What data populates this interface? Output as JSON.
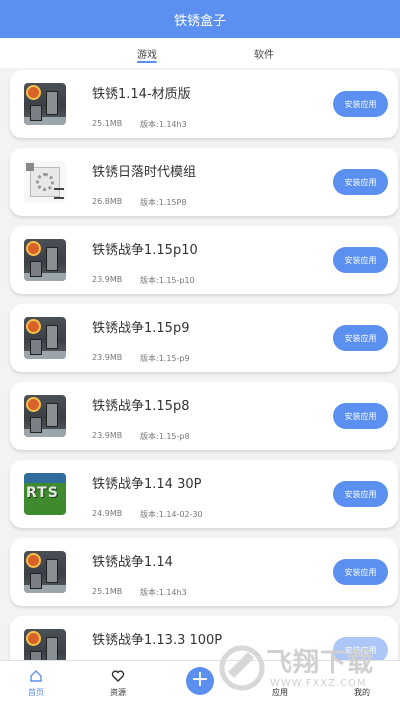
{
  "header": {
    "title": "铁锈盒子"
  },
  "tabs": [
    {
      "label": "游戏",
      "active": true
    },
    {
      "label": "软件",
      "active": false
    }
  ],
  "colors": {
    "accent": "#5b8ff0",
    "background": "#f2f3f5"
  },
  "apps": [
    {
      "name": "铁锈1.14-材质版",
      "size": "25.1MB",
      "version": "版本:1.14h3",
      "icon": "rust-war-icon",
      "button": "安装应用"
    },
    {
      "name": "铁锈日落时代模组",
      "size": "26.8MB",
      "version": "版本:1.15P8",
      "icon": "mod-gear-icon",
      "button": "安装应用"
    },
    {
      "name": "铁锈战争1.15p10",
      "size": "23.9MB",
      "version": "版本:1.15-p10",
      "icon": "rust-war-icon",
      "button": "安装应用"
    },
    {
      "name": "铁锈战争1.15p9",
      "size": "23.9MB",
      "version": "版本:1.15-p9",
      "icon": "rust-war-icon",
      "button": "安装应用"
    },
    {
      "name": "铁锈战争1.15p8",
      "size": "23.9MB",
      "version": "版本:1.15-p8",
      "icon": "rust-war-icon",
      "button": "安装应用"
    },
    {
      "name": "铁锈战争1.14 30P",
      "size": "24.9MB",
      "version": "版本:1.14-02-30",
      "icon": "rts-icon",
      "icon_text": "RTS",
      "button": "安装应用"
    },
    {
      "name": "铁锈战争1.14",
      "size": "25.1MB",
      "version": "版本:1.14h3",
      "icon": "rust-war-icon",
      "button": "安装应用"
    },
    {
      "name": "铁锈战争1.13.3 100P",
      "icon": "rust-war-icon",
      "button": "安装应用"
    }
  ],
  "bottom_nav": [
    {
      "label": "首页",
      "icon": "home-icon",
      "active": true
    },
    {
      "label": "资源",
      "icon": "heart-icon",
      "active": false
    },
    {
      "label": "",
      "icon": "plus-icon",
      "active": false
    },
    {
      "label": "应用",
      "icon": "apps-icon",
      "active": false
    },
    {
      "label": "我的",
      "icon": "user-icon",
      "active": false
    }
  ],
  "watermark": {
    "text": "飞翔下载",
    "url_text": "WWW.FXXZ.COM"
  }
}
